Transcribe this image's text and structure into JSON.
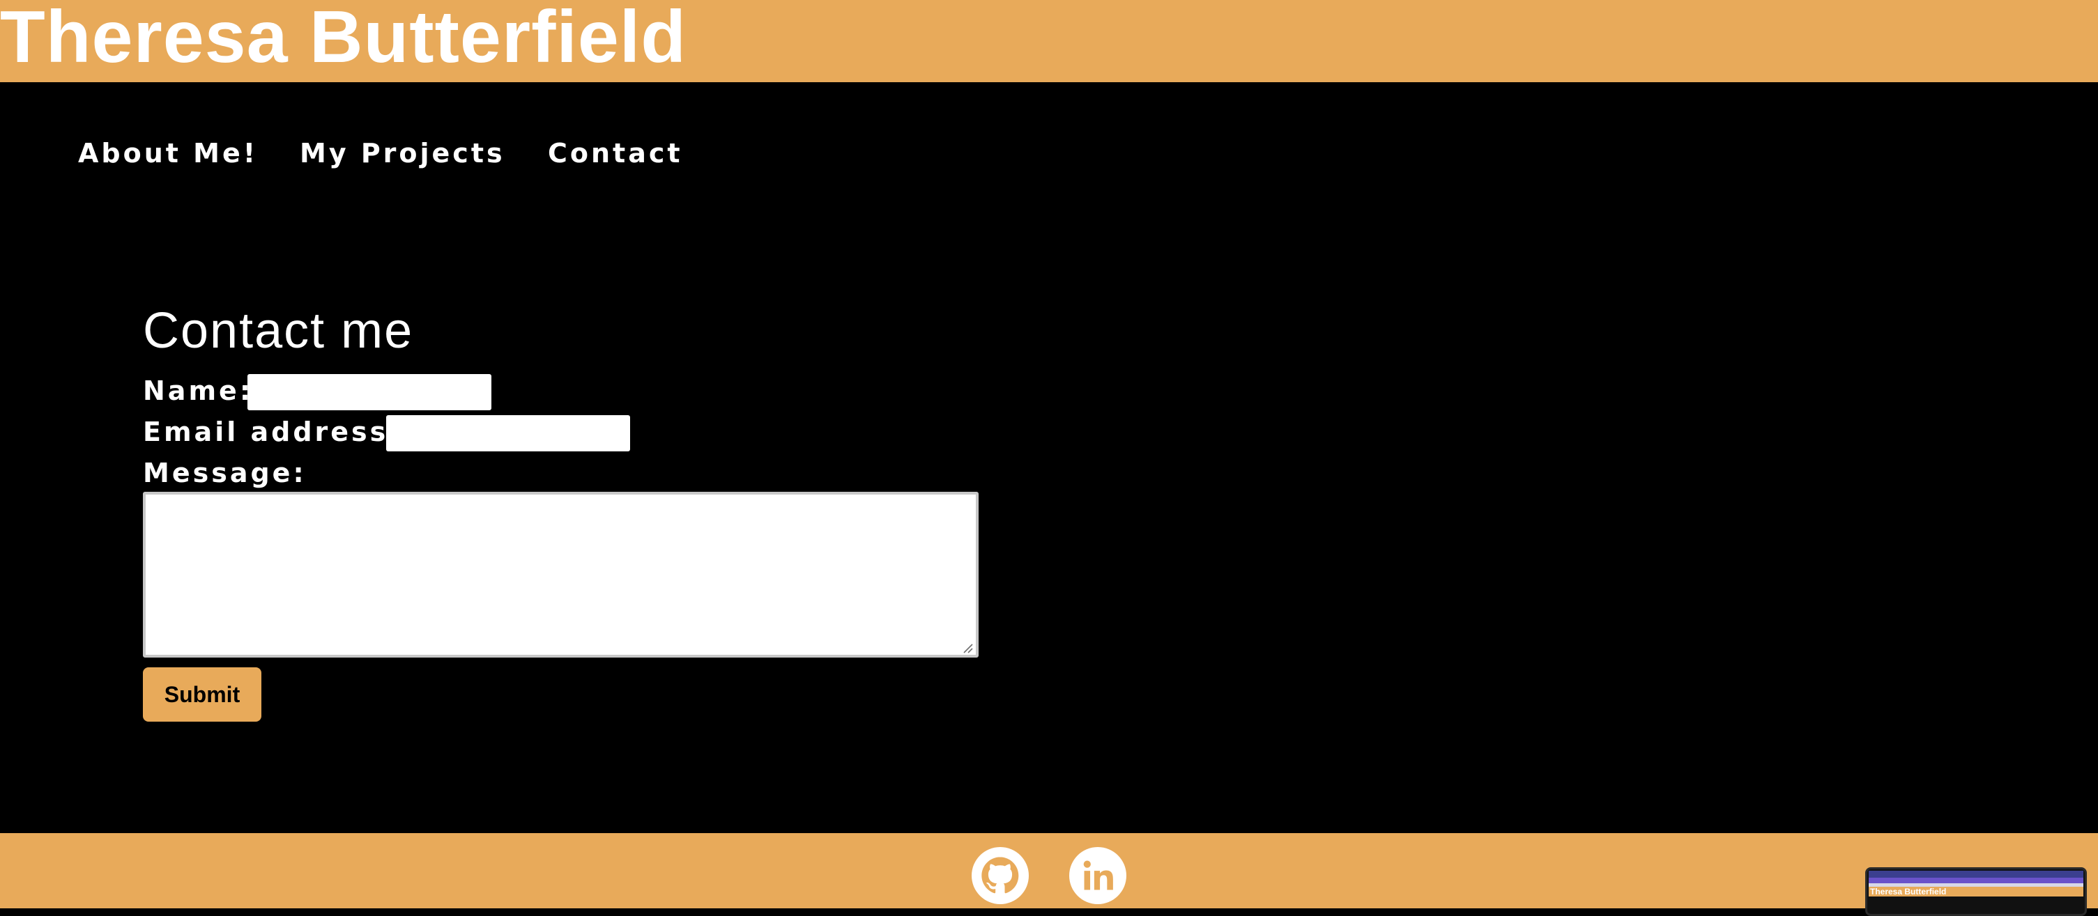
{
  "header": {
    "site_title": "Theresa Butterfield"
  },
  "nav": {
    "items": [
      {
        "label": "About Me!"
      },
      {
        "label": "My Projects"
      },
      {
        "label": "Contact"
      }
    ]
  },
  "contact": {
    "title": "Contact me",
    "name_label": "Name:",
    "name_value": "",
    "email_label": "Email address:",
    "email_value": "",
    "message_label": "Message:",
    "message_value": "",
    "submit_label": "Submit"
  },
  "footer": {
    "social_links": [
      {
        "icon": "github-icon"
      },
      {
        "icon": "linkedin-icon"
      }
    ]
  },
  "thumbnail": {
    "title": "Theresa Butterfield"
  },
  "colors": {
    "accent": "#e8aa5a",
    "background": "#000000",
    "text": "#ffffff"
  }
}
